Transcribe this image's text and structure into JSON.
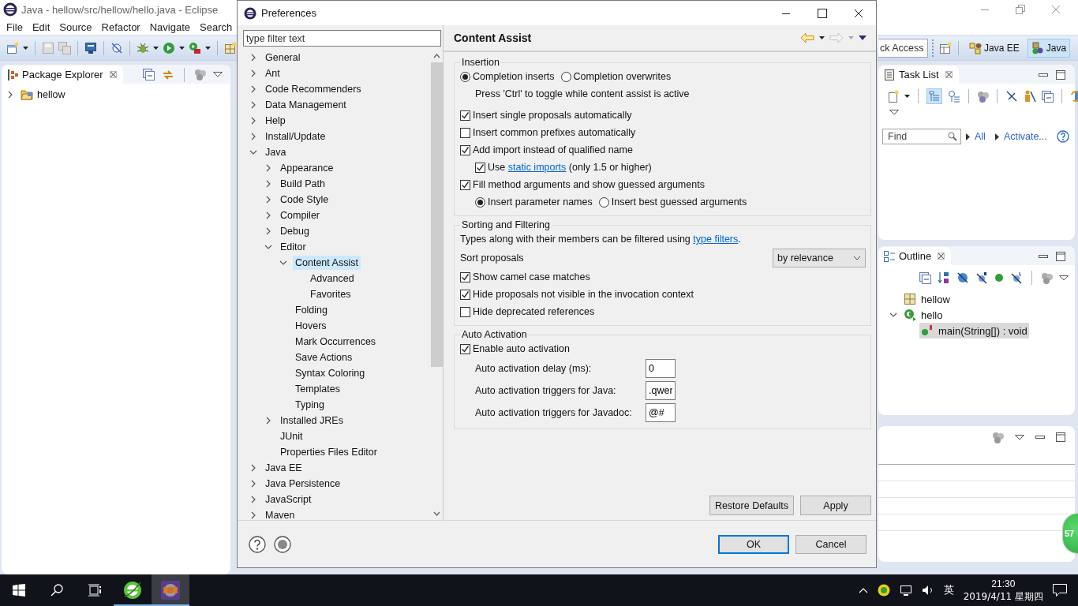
{
  "eclipse": {
    "title": "Java - hellow/src/hellow/hello.java - Eclipse",
    "menu": [
      "File",
      "Edit",
      "Source",
      "Refactor",
      "Navigate",
      "Search"
    ],
    "quick_access": "ck Access",
    "perspectives": [
      {
        "label": "Java EE",
        "selected": false
      },
      {
        "label": "Java",
        "selected": true
      }
    ],
    "package_explorer": {
      "title": "Package Explorer",
      "tree": [
        {
          "label": "hellow",
          "expanded": false,
          "selected": false
        }
      ]
    },
    "task_list": {
      "title": "Task List",
      "find_placeholder": "Find",
      "links": [
        "All",
        "Activate..."
      ]
    },
    "outline": {
      "title": "Outline",
      "tree": [
        {
          "label": "hellow",
          "kind": "package",
          "selected": false
        },
        {
          "label": "hello",
          "kind": "class",
          "expanded": true,
          "selected": false,
          "children": [
            {
              "label": "main(String[]) : void",
              "kind": "method",
              "selected": true
            }
          ]
        }
      ]
    },
    "badge": "57"
  },
  "dialog": {
    "title": "Preferences",
    "filter_placeholder": "type filter text",
    "tree": [
      {
        "label": "General",
        "expanded": false,
        "selected": false
      },
      {
        "label": "Ant",
        "expanded": false,
        "selected": false
      },
      {
        "label": "Code Recommenders",
        "expanded": false,
        "selected": false
      },
      {
        "label": "Data Management",
        "expanded": false,
        "selected": false
      },
      {
        "label": "Help",
        "expanded": false,
        "selected": false
      },
      {
        "label": "Install/Update",
        "expanded": false,
        "selected": false
      },
      {
        "label": "Java",
        "expanded": true,
        "selected": false,
        "children": [
          {
            "label": "Appearance",
            "expanded": false,
            "selected": false
          },
          {
            "label": "Build Path",
            "expanded": false,
            "selected": false
          },
          {
            "label": "Code Style",
            "expanded": false,
            "selected": false
          },
          {
            "label": "Compiler",
            "expanded": false,
            "selected": false
          },
          {
            "label": "Debug",
            "expanded": false,
            "selected": false
          },
          {
            "label": "Editor",
            "expanded": true,
            "selected": false,
            "children": [
              {
                "label": "Content Assist",
                "expanded": true,
                "selected": true,
                "children": [
                  {
                    "label": "Advanced",
                    "selected": false
                  },
                  {
                    "label": "Favorites",
                    "selected": false
                  }
                ]
              },
              {
                "label": "Folding",
                "selected": false
              },
              {
                "label": "Hovers",
                "selected": false
              },
              {
                "label": "Mark Occurrences",
                "selected": false
              },
              {
                "label": "Save Actions",
                "selected": false
              },
              {
                "label": "Syntax Coloring",
                "selected": false
              },
              {
                "label": "Templates",
                "selected": false
              },
              {
                "label": "Typing",
                "selected": false
              }
            ]
          },
          {
            "label": "Installed JREs",
            "expanded": false,
            "selected": false
          },
          {
            "label": "JUnit",
            "selected": false
          },
          {
            "label": "Properties Files Editor",
            "selected": false
          }
        ]
      },
      {
        "label": "Java EE",
        "expanded": false,
        "selected": false
      },
      {
        "label": "Java Persistence",
        "expanded": false,
        "selected": false
      },
      {
        "label": "JavaScript",
        "expanded": false,
        "selected": false
      },
      {
        "label": "Maven",
        "expanded": false,
        "selected": false
      }
    ],
    "page": {
      "title": "Content Assist",
      "groups": [
        {
          "title": "Insertion",
          "items": [
            {
              "kind": "radios",
              "options": [
                {
                  "label": "Completion inserts",
                  "selected": true
                },
                {
                  "label": "Completion overwrites",
                  "selected": false
                }
              ],
              "note": "Press 'Ctrl' to toggle while content assist is active"
            },
            {
              "kind": "checkbox",
              "label": "Insert single proposals automatically",
              "checked": true
            },
            {
              "kind": "checkbox",
              "label": "Insert common prefixes automatically",
              "checked": false
            },
            {
              "kind": "checkbox",
              "label": "Add import instead of qualified name",
              "checked": true,
              "children": [
                {
                  "kind": "checkbox",
                  "label": "Use",
                  "link": "static imports",
                  "after": "(only 1.5 or higher)",
                  "checked": true
                }
              ]
            },
            {
              "kind": "checkbox",
              "label": "Fill method arguments and show guessed arguments",
              "checked": true,
              "children": [
                {
                  "kind": "radios",
                  "options": [
                    {
                      "label": "Insert parameter names",
                      "selected": true
                    },
                    {
                      "label": "Insert best guessed arguments",
                      "selected": false
                    }
                  ]
                }
              ]
            }
          ]
        },
        {
          "title": "Sorting and Filtering",
          "items": [
            {
              "kind": "text",
              "label": "Types along with their members can be filtered using",
              "link": "type filters",
              "after": "."
            },
            {
              "kind": "select",
              "label": "Sort proposals",
              "value": "by relevance"
            },
            {
              "kind": "checkbox",
              "label": "Show camel case matches",
              "checked": true
            },
            {
              "kind": "checkbox",
              "label": "Hide proposals not visible in the invocation context",
              "checked": true
            },
            {
              "kind": "checkbox",
              "label": "Hide deprecated references",
              "checked": false
            }
          ]
        },
        {
          "title": "Auto Activation",
          "items": [
            {
              "kind": "checkbox",
              "label": "Enable auto activation",
              "checked": true,
              "children": [
                {
                  "kind": "field",
                  "label": "Auto activation delay (ms):",
                  "value": "0"
                },
                {
                  "kind": "field",
                  "label": "Auto activation triggers for Java:",
                  "value": ".qwer"
                },
                {
                  "kind": "field",
                  "label": "Auto activation triggers for Javadoc:",
                  "value": "@#"
                }
              ]
            }
          ]
        }
      ],
      "buttons": [
        "Restore Defaults",
        "Apply"
      ]
    },
    "buttons": [
      {
        "label": "OK",
        "default": true
      },
      {
        "label": "Cancel",
        "default": false
      }
    ]
  },
  "taskbar": {
    "apps": [
      {
        "kind": "browser",
        "active": false
      },
      {
        "kind": "eclipse",
        "active": true
      }
    ],
    "tray": {
      "ime": "英",
      "time": "21:30",
      "date": "2019/4/11 星期四"
    }
  }
}
